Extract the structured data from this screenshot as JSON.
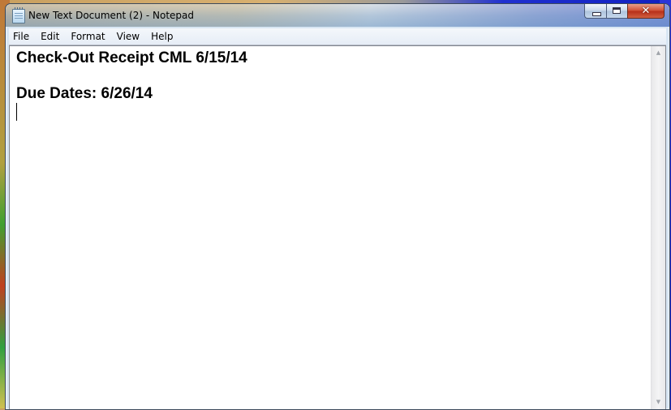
{
  "window": {
    "title": "New Text Document (2) - Notepad",
    "app_icon": "notepad-icon",
    "caption_buttons": {
      "minimize_icon": "minimize-icon",
      "maximize_icon": "maximize-icon",
      "close_glyph": "✕"
    }
  },
  "menubar": {
    "items": [
      {
        "label": "File"
      },
      {
        "label": "Edit"
      },
      {
        "label": "Format"
      },
      {
        "label": "View"
      },
      {
        "label": "Help"
      }
    ]
  },
  "document": {
    "lines": [
      "Check-Out Receipt CML 6/15/14",
      "",
      "Due Dates: 6/26/14",
      ""
    ]
  },
  "scrollbar": {
    "up_glyph": "▲",
    "down_glyph": "▼"
  },
  "colors": {
    "close_button": "#c83c20",
    "editor_background": "#ffffff",
    "menubar": "#eef2f8"
  }
}
